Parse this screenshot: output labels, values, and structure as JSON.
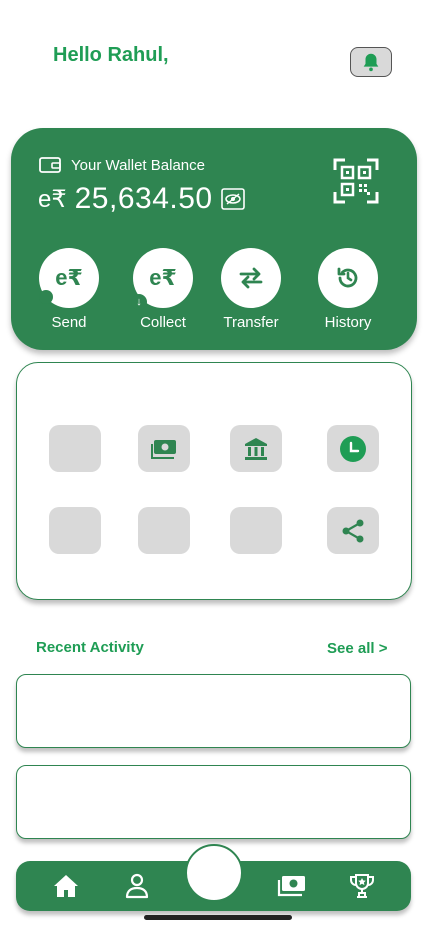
{
  "header": {
    "greeting": "Hello Rahul,"
  },
  "wallet": {
    "label": "Your Wallet Balance",
    "currency_prefix": "e₹",
    "balance": "25,634.50"
  },
  "actions": [
    {
      "id": "send",
      "label": "Send",
      "glyph": "e₹"
    },
    {
      "id": "collect",
      "label": "Collect",
      "glyph": "e₹"
    },
    {
      "id": "transfer",
      "label": "Transfer",
      "glyph": "⇄"
    },
    {
      "id": "history",
      "label": "History",
      "glyph": "history"
    }
  ],
  "recent": {
    "title": "Recent Activity",
    "see_all": "See all >"
  },
  "colors": {
    "primary": "#2f8551",
    "accent_text": "#1f9d55",
    "tile": "#d9d9d9"
  }
}
